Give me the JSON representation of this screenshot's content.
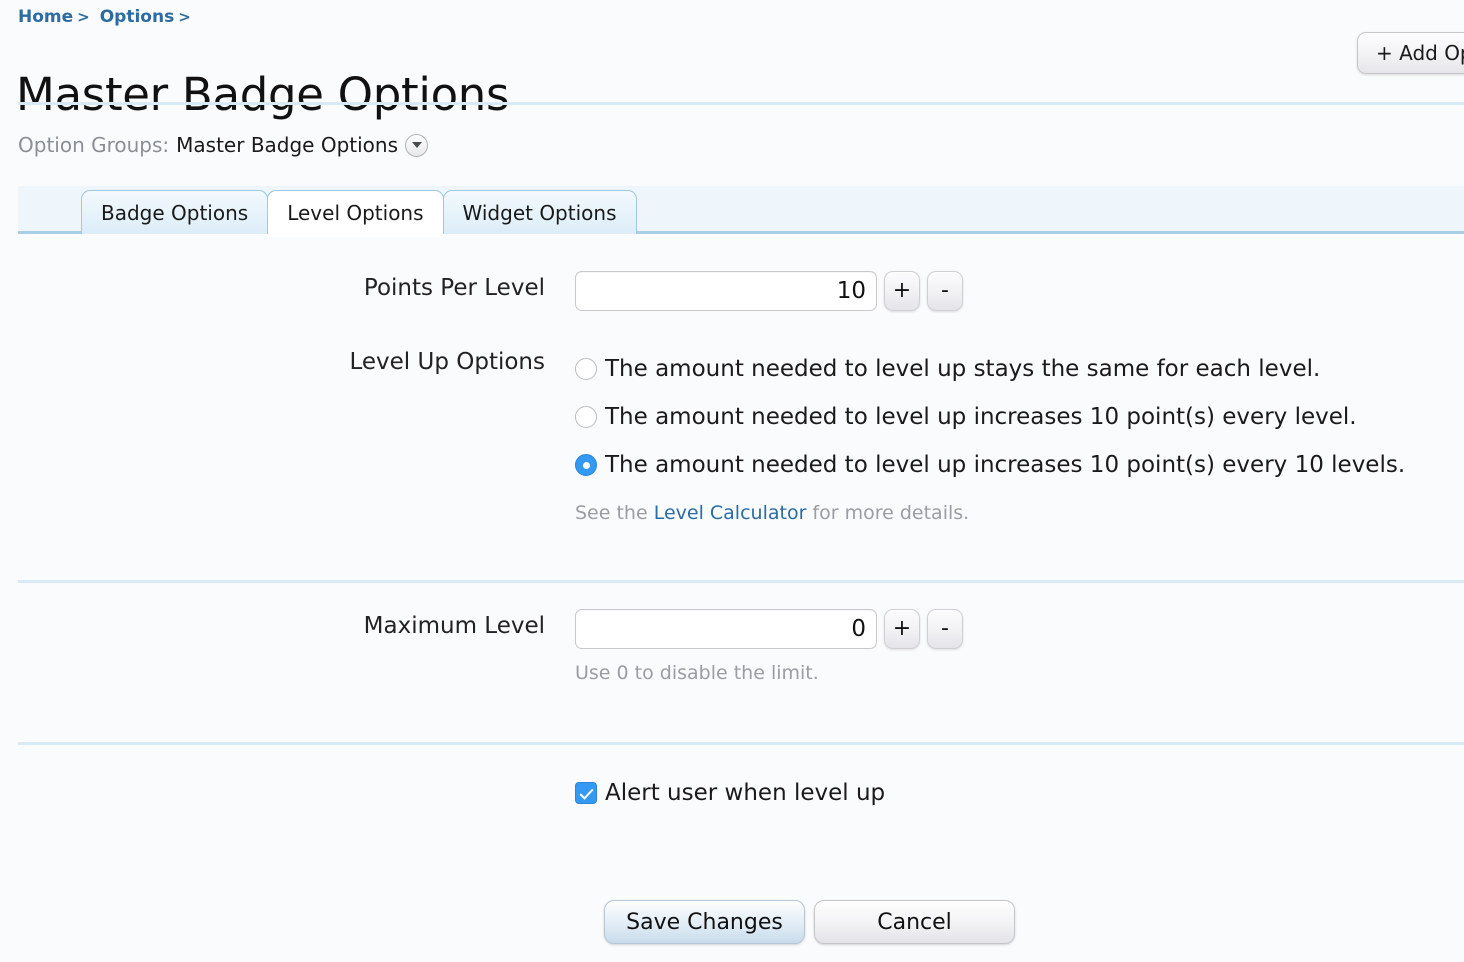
{
  "breadcrumb": {
    "items": [
      {
        "label": "Home",
        "separator": ">"
      },
      {
        "label": "Options",
        "separator": ">"
      }
    ]
  },
  "page_title": "Master Badge Options",
  "header": {
    "add_option_label": "+ Add Op"
  },
  "option_groups": {
    "label": "Option Groups:",
    "value": "Master Badge Options",
    "dropdown_icon": "chevron-down-circle-icon"
  },
  "tabs": [
    {
      "label": "Badge Options",
      "active": false
    },
    {
      "label": "Level Options",
      "active": true
    },
    {
      "label": "Widget Options",
      "active": false
    }
  ],
  "form": {
    "points_per_level": {
      "label": "Points Per Level",
      "value": "10",
      "increment_label": "+",
      "decrement_label": "-"
    },
    "level_up_options": {
      "label": "Level Up Options",
      "options": [
        {
          "text": "The amount needed to level up stays the same for each level.",
          "selected": false
        },
        {
          "text": "The amount needed to level up increases 10 point(s) every level.",
          "selected": false
        },
        {
          "text": "The amount needed to level up increases 10 point(s) every 10 levels.",
          "selected": true
        }
      ],
      "hint_prefix": "See the ",
      "hint_link": "Level Calculator",
      "hint_suffix": " for more details."
    },
    "maximum_level": {
      "label": "Maximum Level",
      "value": "0",
      "increment_label": "+",
      "decrement_label": "-",
      "hint": "Use 0 to disable the limit."
    },
    "alert_checkbox": {
      "label": "Alert user when level up",
      "checked": true
    }
  },
  "actions": {
    "save_label": "Save Changes",
    "cancel_label": "Cancel"
  },
  "colors": {
    "link": "#2b6ca3",
    "accent": "#3399f3",
    "rule": "#d8eaf6",
    "tab_border": "#9fc8e2",
    "background": "#fafbfc",
    "muted_text": "#9a9da1"
  }
}
